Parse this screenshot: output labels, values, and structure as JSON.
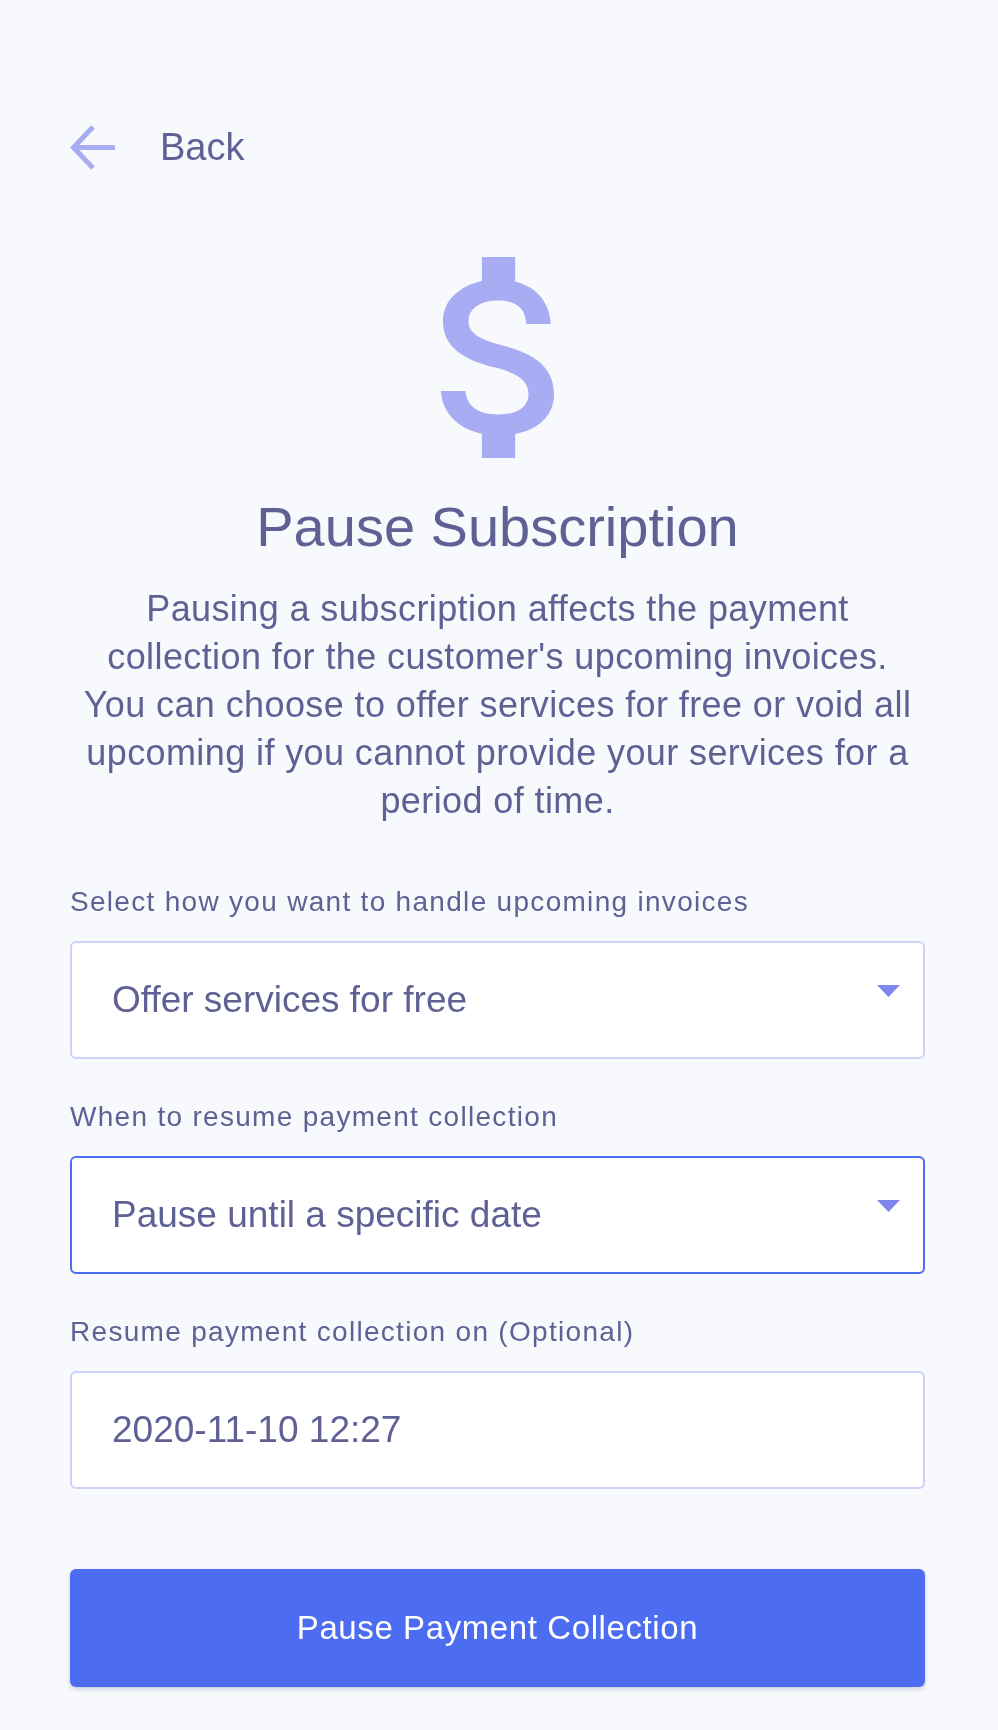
{
  "back": {
    "label": "Back"
  },
  "title": "Pause Subscription",
  "description": "Pausing a subscription affects the payment collection for the customer's upcoming invoices. You can choose to offer services for free or void all upcoming if you cannot provide your services for a period of time.",
  "fields": [
    {
      "kind": "select",
      "label": "Select how you want to handle upcoming invoices",
      "value": "Offer services for free",
      "focused": false
    },
    {
      "kind": "select",
      "label": "When to resume payment collection",
      "value": "Pause until a specific date",
      "focused": true
    },
    {
      "kind": "input",
      "label": "Resume payment collection on (Optional)",
      "value": "2020-11-10 12:27",
      "focused": false
    }
  ],
  "submit": {
    "label": "Pause Payment Collection"
  }
}
